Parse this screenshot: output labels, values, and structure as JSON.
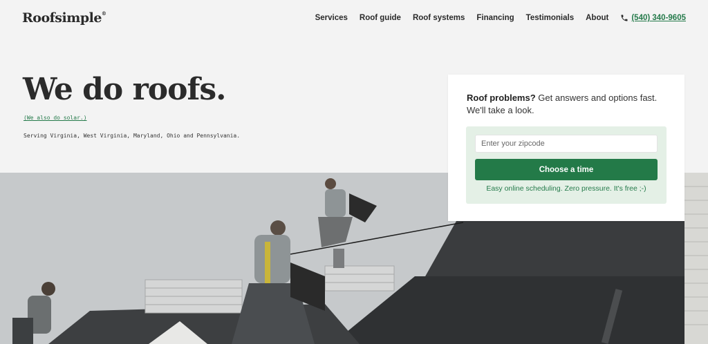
{
  "header": {
    "logo": "Roofsimple",
    "logo_mark": "®",
    "nav": [
      "Services",
      "Roof guide",
      "Roof systems",
      "Financing",
      "Testimonials",
      "About"
    ],
    "phone": "(540) 340-9605"
  },
  "hero": {
    "title": "We do roofs.",
    "solar_link": "(We also do solar.)",
    "serving": "Serving Virginia, West Virginia, Maryland, Ohio and Pennsylvania."
  },
  "card": {
    "lead_bold": "Roof problems?",
    "lead_rest": " Get answers and options fast. We'll take a look.",
    "zip_placeholder": "Enter your zipcode",
    "button": "Choose a time",
    "note": "Easy online scheduling. Zero pressure. It's free ;-)"
  },
  "colors": {
    "accent": "#237a48",
    "background": "#f3f3f3",
    "card_inner": "#e4f0e6"
  }
}
